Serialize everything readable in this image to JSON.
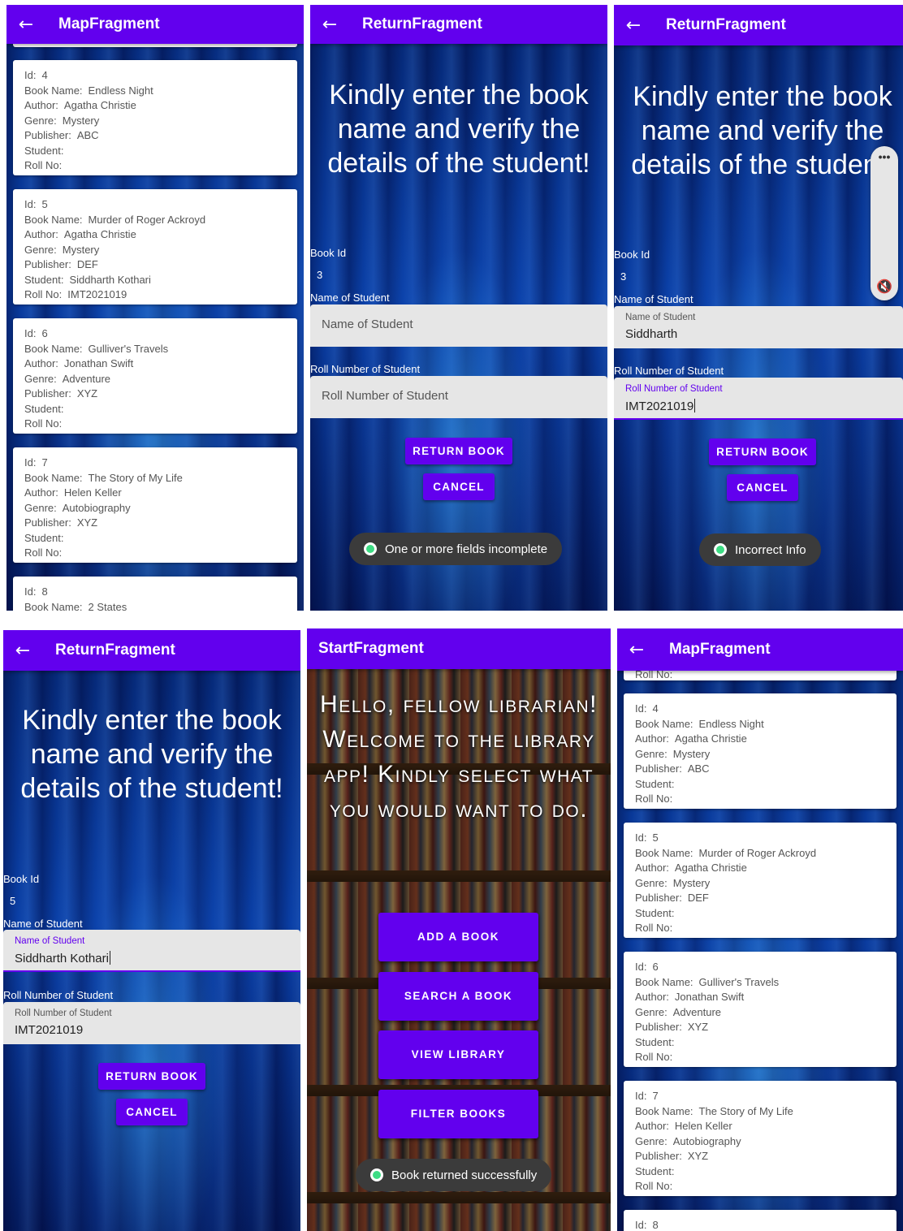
{
  "map_title": "MapFragment",
  "return_title": "ReturnFragment",
  "start_title": "StartFragment",
  "back_glyph": "←",
  "field_keys": {
    "id": "Id:",
    "book_name": "Book Name:",
    "author": "Author:",
    "genre": "Genre:",
    "publisher": "Publisher:",
    "student": "Student:",
    "roll_no": "Roll No:"
  },
  "books": [
    {
      "id": "4",
      "book_name": "Endless Night",
      "author": "Agatha Christie",
      "genre": "Mystery",
      "publisher": "ABC",
      "student": "",
      "roll_no": ""
    },
    {
      "id": "5",
      "book_name": "Murder of Roger Ackroyd",
      "author": "Agatha Christie",
      "genre": "Mystery",
      "publisher": "DEF",
      "student": "Siddharth Kothari",
      "roll_no": "IMT2021019"
    },
    {
      "id": "6",
      "book_name": "Gulliver's Travels",
      "author": "Jonathan Swift",
      "genre": "Adventure",
      "publisher": "XYZ",
      "student": "",
      "roll_no": ""
    },
    {
      "id": "7",
      "book_name": "The Story of My Life",
      "author": "Helen Keller",
      "genre": "Autobiography",
      "publisher": "XYZ",
      "student": "",
      "roll_no": ""
    },
    {
      "id": "8",
      "book_name": "2 States"
    }
  ],
  "books_after_return": [
    {
      "id": "4",
      "book_name": "Endless Night",
      "author": "Agatha Christie",
      "genre": "Mystery",
      "publisher": "ABC",
      "student": "",
      "roll_no": ""
    },
    {
      "id": "5",
      "book_name": "Murder of Roger Ackroyd",
      "author": "Agatha Christie",
      "genre": "Mystery",
      "publisher": "DEF",
      "student": "",
      "roll_no": ""
    },
    {
      "id": "6",
      "book_name": "Gulliver's Travels",
      "author": "Jonathan Swift",
      "genre": "Adventure",
      "publisher": "XYZ",
      "student": "",
      "roll_no": ""
    },
    {
      "id": "7",
      "book_name": "The Story of My Life",
      "author": "Helen Keller",
      "genre": "Autobiography",
      "publisher": "XYZ",
      "student": "",
      "roll_no": ""
    },
    {
      "id": "8"
    }
  ],
  "partial_roll_label": "Roll No:",
  "return_form": {
    "heading": "Kindly enter the book name and verify the details of the student!",
    "book_id_label": "Book Id",
    "student_label": "Name of Student",
    "student_hint": "Name of Student",
    "roll_label": "Roll Number of Student",
    "roll_hint": "Roll Number of Student",
    "return_button": "RETURN BOOK",
    "cancel_button": "CANCEL"
  },
  "screen2": {
    "book_id": "3",
    "toast": "One or more fields incomplete"
  },
  "screen3": {
    "book_id": "3",
    "student_value": "Siddharth",
    "roll_value": "IMT2021019",
    "toast": "Incorrect Info",
    "volume_dots": "•••",
    "mute_glyph": "🔇"
  },
  "screen4": {
    "book_id": "5",
    "student_value": "Siddharth Kothari",
    "roll_value": "IMT2021019"
  },
  "start": {
    "welcome": "Hello, fellow librarian! Welcome to the library app! Kindly select what you would want to do.",
    "add_button": "ADD A BOOK",
    "search_button": "SEARCH A BOOK",
    "view_button": "VIEW LIBRARY",
    "filter_button": "FILTER BOOKS",
    "toast": "Book returned successfully"
  }
}
